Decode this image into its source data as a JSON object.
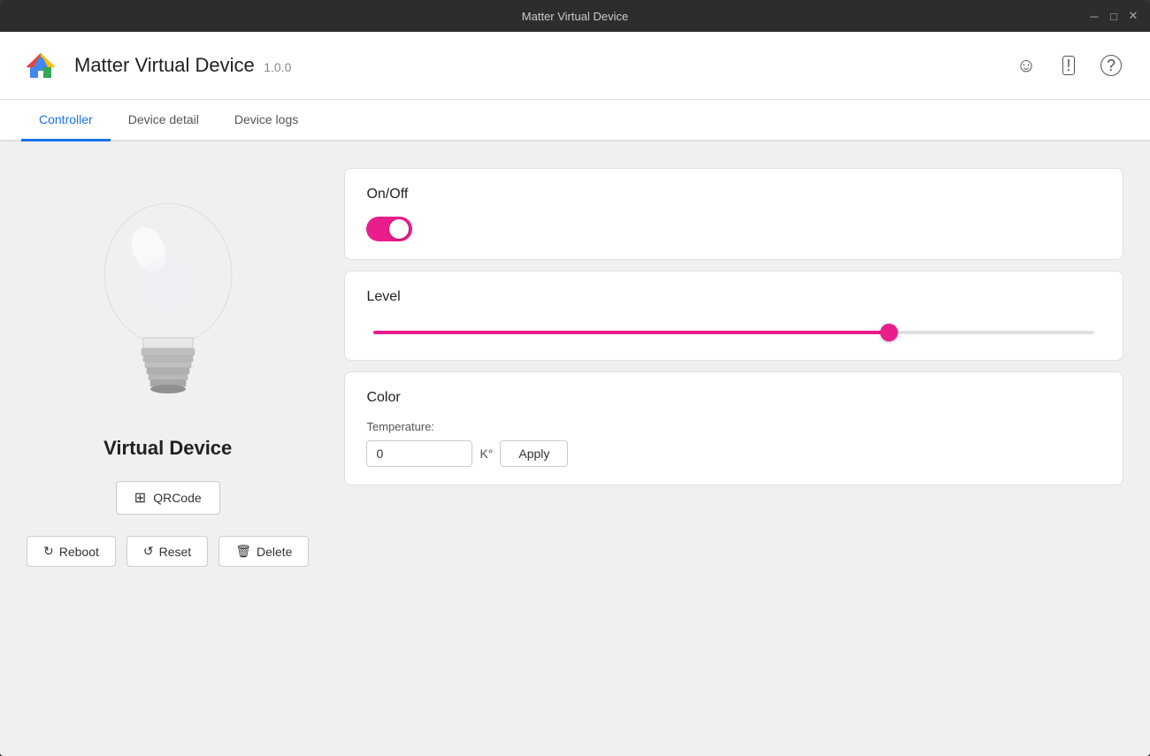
{
  "titlebar": {
    "title": "Matter Virtual Device",
    "minimize_label": "─",
    "maximize_label": "□",
    "close_label": "✕"
  },
  "header": {
    "app_title": "Matter Virtual Device",
    "app_version": "1.0.0",
    "icons": {
      "smiley": "☺",
      "feedback": "⊡",
      "help": "?"
    }
  },
  "tabs": [
    {
      "id": "controller",
      "label": "Controller",
      "active": true
    },
    {
      "id": "device-detail",
      "label": "Device detail",
      "active": false
    },
    {
      "id": "device-logs",
      "label": "Device logs",
      "active": false
    }
  ],
  "left_panel": {
    "device_name": "Virtual Device",
    "qrcode_btn_label": "QRCode",
    "reboot_btn_label": "Reboot",
    "reset_btn_label": "Reset",
    "delete_btn_label": "Delete"
  },
  "on_off_card": {
    "title": "On/Off",
    "state": true
  },
  "level_card": {
    "title": "Level",
    "value": 72,
    "min": 0,
    "max": 100
  },
  "color_card": {
    "title": "Color",
    "temperature_label": "Temperature:",
    "temperature_value": "0",
    "temperature_unit": "K°",
    "apply_btn_label": "Apply"
  }
}
